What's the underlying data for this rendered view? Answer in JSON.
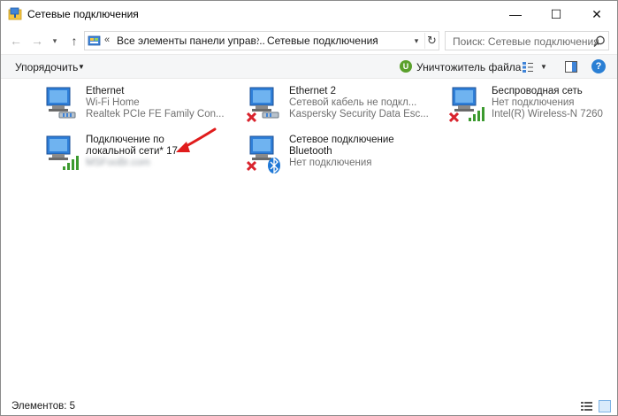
{
  "window": {
    "title": "Сетевые подключения",
    "controls": {
      "minimize": "—",
      "maximize": "☐",
      "close": "✕"
    }
  },
  "navigation": {
    "back": "←",
    "forward": "→",
    "recent": "▾",
    "up": "↑",
    "address": {
      "prefix": "«",
      "crumb1": "Все элементы панели управ...",
      "sep1": "›",
      "crumb2": "Сетевые подключения",
      "sep2": "›",
      "dropdown": "▾",
      "refresh": "↻"
    },
    "search": {
      "placeholder": "Поиск: Сетевые подключения"
    }
  },
  "commandbar": {
    "organize": "Упорядочить",
    "organize_caret": "▼",
    "shredder_badge": "U",
    "shredder": "Уничтожитель файла",
    "view_caret": "▼",
    "help": "?"
  },
  "connections": [
    {
      "name": "Ethernet",
      "status": "Wi-Fi Home",
      "device": "Realtek PCIe FE Family Con...",
      "icon": "ethernet-connected"
    },
    {
      "name": "Ethernet 2",
      "status": "Сетевой кабель не подкл...",
      "device": "Kaspersky Security Data Esc...",
      "icon": "ethernet-disconnected"
    },
    {
      "name": "Беспроводная сеть",
      "status": "Нет подключения",
      "device": "Intel(R) Wireless-N 7260",
      "icon": "wifi-disconnected"
    },
    {
      "name": "Подключение по",
      "name2": "локальной сети* 17",
      "device": "MSFooBr.com",
      "icon": "wifi-connected"
    },
    {
      "name": "Сетевое подключение",
      "name2": "Bluetooth",
      "status": "Нет подключения",
      "icon": "bluetooth-disconnected"
    }
  ],
  "statusbar": {
    "count": "Элементов: 5"
  },
  "colors": {
    "accent": "#2a7fd4",
    "error_red": "#d9232d",
    "signal_green": "#3c9a2f",
    "arrow_red": "#e01c1c"
  }
}
